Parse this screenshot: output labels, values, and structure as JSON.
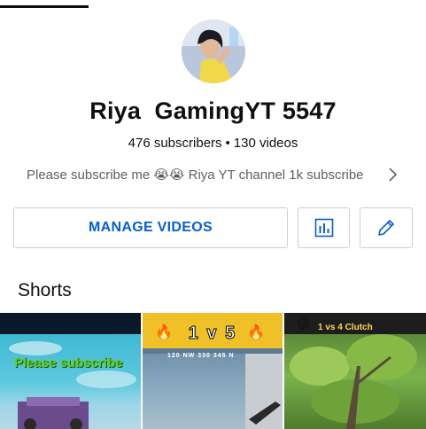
{
  "channel": {
    "name": "Riya  GamingYT 5547",
    "subscribers": "476 subscribers",
    "separator": "•",
    "videos": "130 videos",
    "description": "Please subscribe me 😭😭 Riya YT channel 1k subscribe"
  },
  "actions": {
    "manage_videos_label": "MANAGE VIDEOS"
  },
  "shorts": {
    "title": "Shorts",
    "items": [
      {
        "overlay_text": "Please subscribe"
      },
      {
        "overlay_text": "1 v 5",
        "compass": "120  NW  330  345  N"
      },
      {
        "overlay_text": "1 vs 4 Clutch"
      }
    ]
  },
  "colors": {
    "link_blue": "#065fd4",
    "text_primary": "#0f0f0f",
    "text_secondary": "#606060",
    "border": "#cfcfcf"
  }
}
